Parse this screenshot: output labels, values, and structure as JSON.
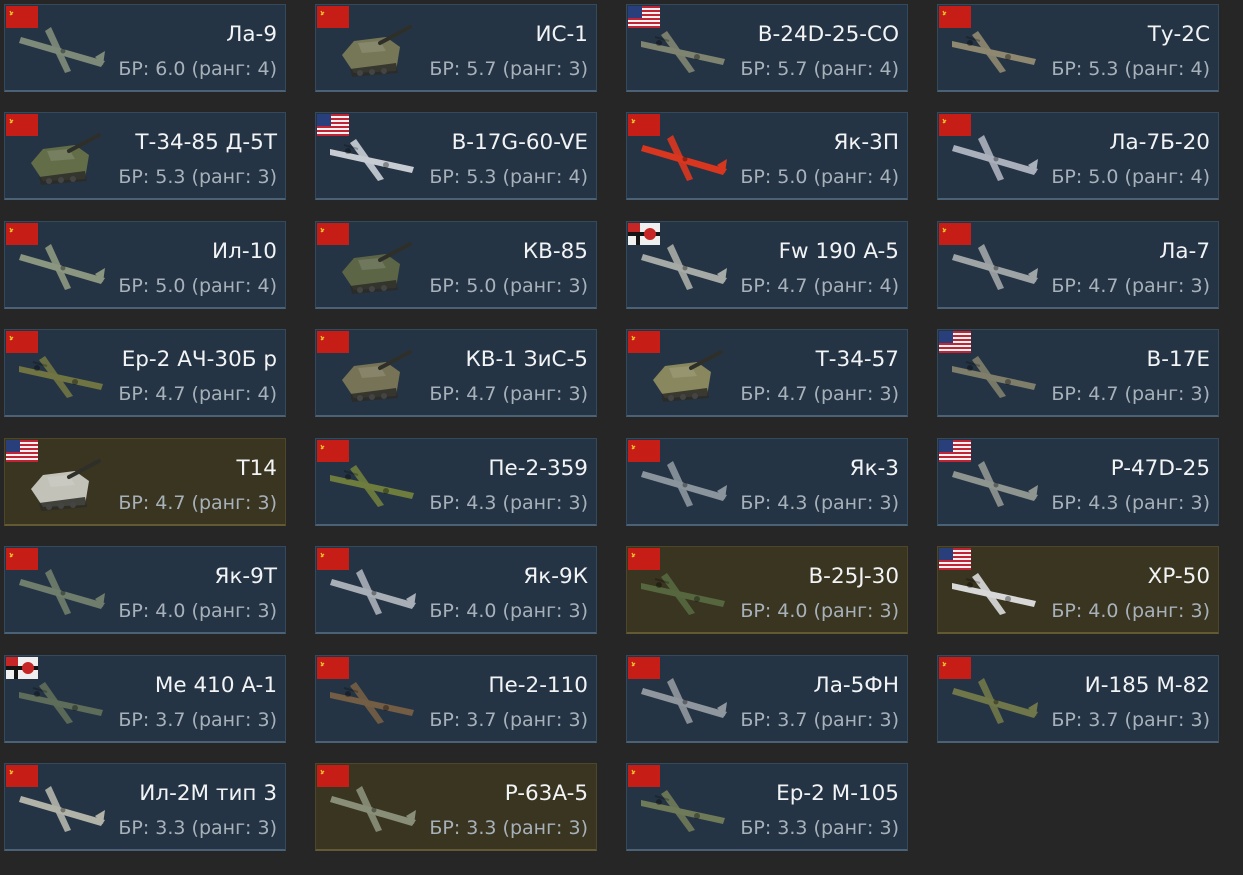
{
  "colors": {
    "card_bg": "#253444",
    "card_premium_bg": "#3a3520",
    "page_bg": "#262626",
    "name_text": "#f1f3f5",
    "br_text": "#a7b1ba"
  },
  "vehicles": [
    {
      "name": "Ла-9",
      "br": "БР: 6.0 (ранг: 4)",
      "nation": "ussr",
      "kind": "plane",
      "premium": false,
      "tint": "#7d8a7a"
    },
    {
      "name": "ИС-1",
      "br": "БР: 5.7 (ранг: 3)",
      "nation": "ussr",
      "kind": "tank",
      "premium": false,
      "tint": "#7a7a58"
    },
    {
      "name": "B-24D-25-CO",
      "br": "БР: 5.7 (ранг: 4)",
      "nation": "usa",
      "kind": "bomber",
      "premium": false,
      "tint": "#7f8471"
    },
    {
      "name": "Ту-2С",
      "br": "БР: 5.3 (ранг: 4)",
      "nation": "ussr",
      "kind": "bomber",
      "premium": false,
      "tint": "#8e8870"
    },
    {
      "name": "Т-34-85 Д-5Т",
      "br": "БР: 5.3 (ранг: 3)",
      "nation": "ussr",
      "kind": "tank",
      "premium": false,
      "tint": "#66704a"
    },
    {
      "name": "B-17G-60-VE",
      "br": "БР: 5.3 (ранг: 4)",
      "nation": "usa",
      "kind": "bomber",
      "premium": false,
      "tint": "#c7ccd2"
    },
    {
      "name": "Як-3П",
      "br": "БР: 5.0 (ранг: 4)",
      "nation": "ussr",
      "kind": "plane",
      "premium": false,
      "tint": "#d8361f"
    },
    {
      "name": "Ла-7Б-20",
      "br": "БР: 5.0 (ранг: 4)",
      "nation": "ussr",
      "kind": "plane",
      "premium": false,
      "tint": "#a9b0bc"
    },
    {
      "name": "Ил-10",
      "br": "БР: 5.0 (ранг: 4)",
      "nation": "ussr",
      "kind": "plane",
      "premium": false,
      "tint": "#8b9680"
    },
    {
      "name": "КВ-85",
      "br": "БР: 5.0 (ранг: 3)",
      "nation": "ussr",
      "kind": "tank",
      "premium": false,
      "tint": "#5f6847"
    },
    {
      "name": "Fw 190 A-5",
      "br": "БР: 4.7 (ранг: 4)",
      "nation": "germany",
      "kind": "plane",
      "premium": false,
      "tint": "#a6aaa6"
    },
    {
      "name": "Ла-7",
      "br": "БР: 4.7 (ранг: 3)",
      "nation": "ussr",
      "kind": "plane",
      "premium": false,
      "tint": "#9ea3a6"
    },
    {
      "name": "Ер-2 АЧ-30Б р",
      "br": "БР: 4.7 (ранг: 4)",
      "nation": "ussr",
      "kind": "bomber",
      "premium": false,
      "tint": "#6f7442"
    },
    {
      "name": "КВ-1 ЗиС-5",
      "br": "БР: 4.7 (ранг: 3)",
      "nation": "ussr",
      "kind": "tank",
      "premium": false,
      "tint": "#7b7657"
    },
    {
      "name": "Т-34-57",
      "br": "БР: 4.7 (ранг: 3)",
      "nation": "ussr",
      "kind": "tank",
      "premium": false,
      "tint": "#8d8a5f"
    },
    {
      "name": "B-17E",
      "br": "БР: 4.7 (ранг: 3)",
      "nation": "usa",
      "kind": "bomber",
      "premium": false,
      "tint": "#7f7e6b"
    },
    {
      "name": "T14",
      "br": "БР: 4.7 (ранг: 3)",
      "nation": "usa",
      "kind": "tank",
      "premium": true,
      "tint": "#c9c8c0"
    },
    {
      "name": "Пе-2-359",
      "br": "БР: 4.3 (ранг: 3)",
      "nation": "ussr",
      "kind": "bomber",
      "premium": false,
      "tint": "#6e7d3d"
    },
    {
      "name": "Як-3",
      "br": "БР: 4.3 (ранг: 3)",
      "nation": "ussr",
      "kind": "plane",
      "premium": false,
      "tint": "#8a949c"
    },
    {
      "name": "P-47D-25",
      "br": "БР: 4.3 (ранг: 3)",
      "nation": "usa",
      "kind": "plane",
      "premium": false,
      "tint": "#8e948f"
    },
    {
      "name": "Як-9Т",
      "br": "БР: 4.0 (ранг: 3)",
      "nation": "ussr",
      "kind": "plane",
      "premium": false,
      "tint": "#6f7d6c"
    },
    {
      "name": "Як-9К",
      "br": "БР: 4.0 (ранг: 3)",
      "nation": "ussr",
      "kind": "plane",
      "premium": false,
      "tint": "#a7aeb6"
    },
    {
      "name": "B-25J-30",
      "br": "БР: 4.0 (ранг: 3)",
      "nation": "ussr",
      "kind": "bomber",
      "premium": true,
      "tint": "#56673f"
    },
    {
      "name": "XP-50",
      "br": "БР: 4.0 (ранг: 3)",
      "nation": "usa",
      "kind": "bomber",
      "premium": true,
      "tint": "#d8d8d8"
    },
    {
      "name": "Me 410 A-1",
      "br": "БР: 3.7 (ранг: 3)",
      "nation": "germany",
      "kind": "bomber",
      "premium": false,
      "tint": "#5e6c5a"
    },
    {
      "name": "Пе-2-110",
      "br": "БР: 3.7 (ранг: 3)",
      "nation": "ussr",
      "kind": "bomber",
      "premium": false,
      "tint": "#735d44"
    },
    {
      "name": "Ла-5ФН",
      "br": "БР: 3.7 (ранг: 3)",
      "nation": "ussr",
      "kind": "plane",
      "premium": false,
      "tint": "#8f969d"
    },
    {
      "name": "И-185 М-82",
      "br": "БР: 3.7 (ранг: 3)",
      "nation": "ussr",
      "kind": "plane",
      "premium": false,
      "tint": "#6f7649"
    },
    {
      "name": "Ил-2М тип 3",
      "br": "БР: 3.3 (ранг: 3)",
      "nation": "ussr",
      "kind": "plane",
      "premium": false,
      "tint": "#b1b3a9"
    },
    {
      "name": "P-63A-5",
      "br": "БР: 3.3 (ранг: 3)",
      "nation": "ussr",
      "kind": "plane",
      "premium": true,
      "tint": "#888e78"
    },
    {
      "name": "Ер-2 М-105",
      "br": "БР: 3.3 (ранг: 3)",
      "nation": "ussr",
      "kind": "bomber",
      "premium": false,
      "tint": "#6f7a59"
    }
  ]
}
